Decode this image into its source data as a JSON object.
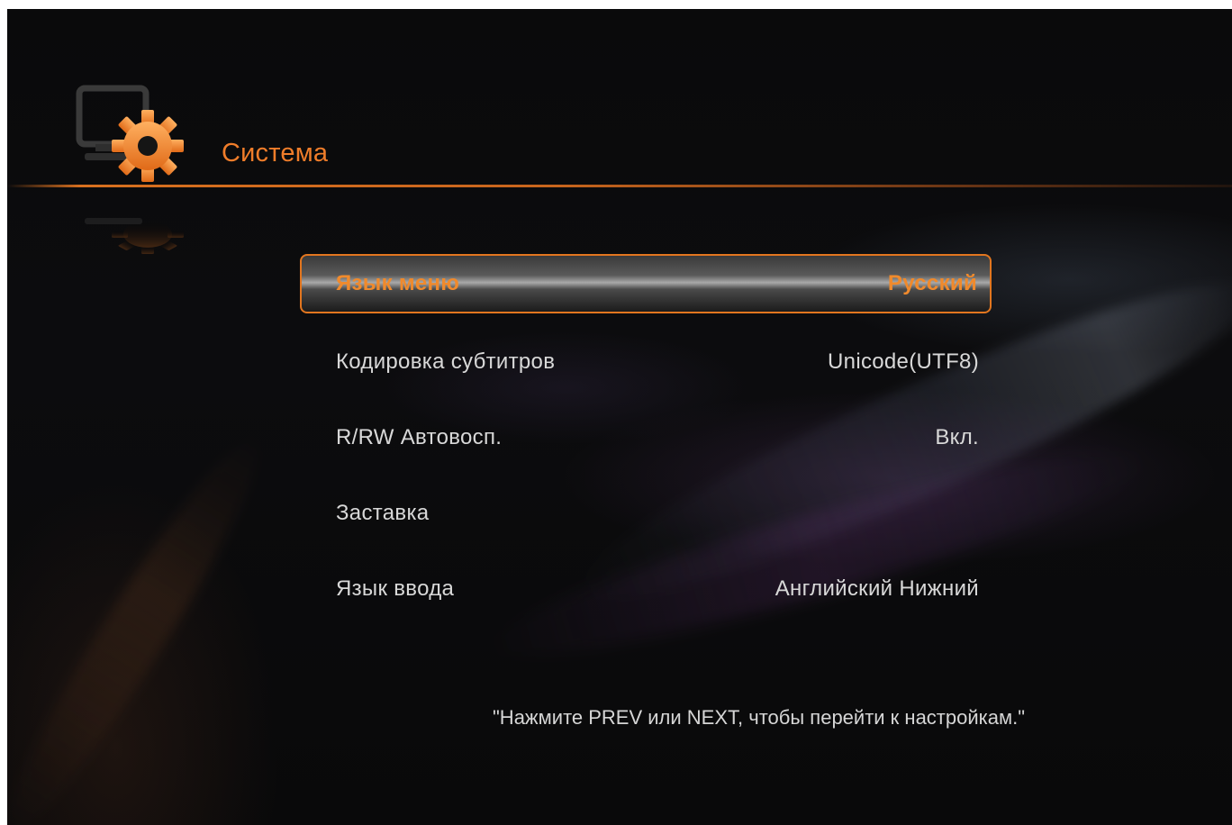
{
  "header": {
    "title": "Система",
    "icon": "system-settings-gear-icon"
  },
  "menu": {
    "items": [
      {
        "label": "Язык меню",
        "value": "Русский",
        "selected": true
      },
      {
        "label": "Кодировка субтитров",
        "value": "Unicode(UTF8)",
        "selected": false
      },
      {
        "label": "R/RW Автовосп.",
        "value": "Вкл.",
        "selected": false
      },
      {
        "label": "Заставка",
        "value": "",
        "selected": false
      },
      {
        "label": "Язык ввода",
        "value": "Английский Нижний",
        "selected": false
      }
    ]
  },
  "hint": "\"Нажмите PREV или NEXT, чтобы перейти к настройкам.\"",
  "colors": {
    "accent": "#f07d2a",
    "text": "#d8d8d8",
    "background": "#0b0b0c"
  }
}
